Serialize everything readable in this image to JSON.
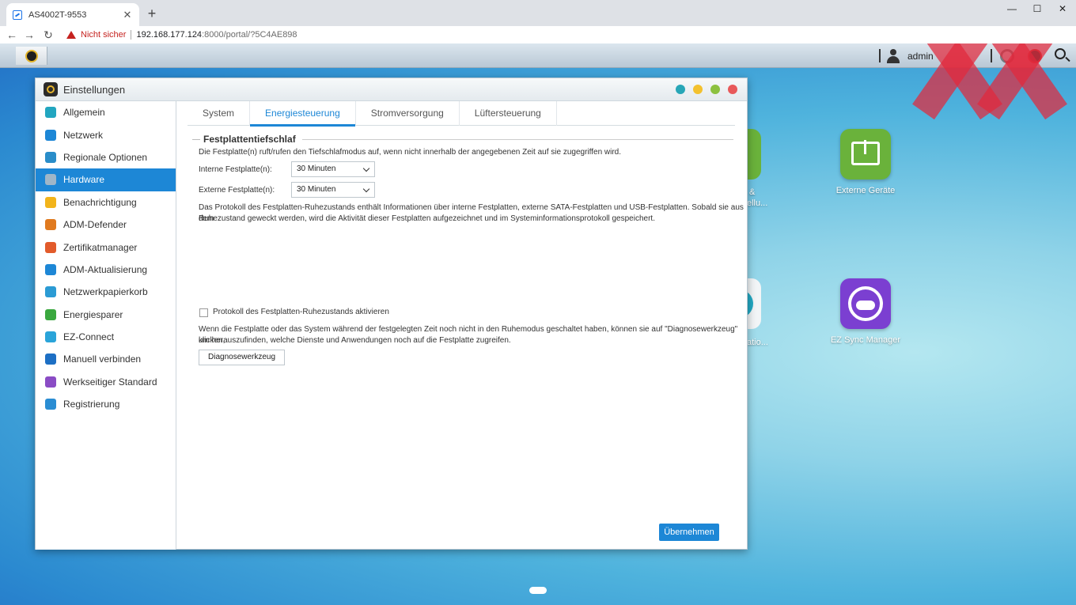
{
  "browser": {
    "tab_title": "AS4002T-9553",
    "insecure_label": "Nicht sicher",
    "url_host": "192.168.177.124",
    "url_path": ":8000/portal/?5C4AE898"
  },
  "taskbar": {
    "username": "admin"
  },
  "desktop": {
    "apps": [
      {
        "label": "Externe Geräte",
        "color": "#6ab23b"
      },
      {
        "label": "EZ Sync Manager",
        "color": "#7b3fd1"
      }
    ],
    "partial_labels": [
      "&",
      "ellu...",
      "atio..."
    ]
  },
  "window": {
    "title": "Einstellungen",
    "dot_colors": [
      "#27a6b7",
      "#f3c12e",
      "#8cc13f",
      "#e8595a"
    ]
  },
  "sidebar": {
    "items": [
      {
        "label": "Allgemein",
        "color": "#22a6c0"
      },
      {
        "label": "Netzwerk",
        "color": "#1d87d6"
      },
      {
        "label": "Regionale Optionen",
        "color": "#2a8dc9"
      },
      {
        "label": "Hardware",
        "color": "#9fb6c8"
      },
      {
        "label": "Benachrichtigung",
        "color": "#f2b41b"
      },
      {
        "label": "ADM-Defender",
        "color": "#e07a1f"
      },
      {
        "label": "Zertifikatmanager",
        "color": "#e25b2b"
      },
      {
        "label": "ADM-Aktualisierung",
        "color": "#1d87d6"
      },
      {
        "label": "Netzwerkpapierkorb",
        "color": "#2b9bd4"
      },
      {
        "label": "Energiesparer",
        "color": "#3aa83f"
      },
      {
        "label": "EZ-Connect",
        "color": "#2aa4d9"
      },
      {
        "label": "Manuell verbinden",
        "color": "#1d6fc4"
      },
      {
        "label": "Werkseitiger Standard",
        "color": "#8a4cc5"
      },
      {
        "label": "Registrierung",
        "color": "#2a8dd3"
      }
    ],
    "active_index": 3
  },
  "tabs": [
    "System",
    "Energiesteuerung",
    "Stromversorgung",
    "Lüftersteuerung"
  ],
  "active_tab": 1,
  "section": {
    "title": "Festplattentiefschlaf",
    "description": "Die Festplatte(n) ruft/rufen den Tiefschlafmodus auf, wenn nicht innerhalb der angegebenen Zeit auf sie zugegriffen wird.",
    "internal_label": "Interne Festplatte(n):",
    "internal_value": "30 Minuten",
    "external_label": "Externe Festplatte(n):",
    "external_value": "30 Minuten",
    "log_info_line1": "Das Protokoll des Festplatten-Ruhezustands enthält Informationen über interne Festplatten, externe SATA-Festplatten und USB-Festplatten. Sobald sie aus dem",
    "log_info_line2": "Ruhezustand geweckt werden, wird die Aktivität dieser Festplatten aufgezeichnet und im Systeminformationsprotokoll gespeichert.",
    "checkbox_label": "Protokoll des Festplatten-Ruhezustands aktivieren",
    "checkbox_checked": false,
    "diag_info_line1": "Wenn die Festplatte oder das System während der festgelegten Zeit noch nicht in den Ruhemodus geschaltet haben, können sie auf \"Diagnosewerkzeug\" klicken,",
    "diag_info_line2": "um herauszufinden, welche Dienste und Anwendungen noch auf die Festplatte zugreifen.",
    "diag_button": "Diagnosewerkzeug",
    "apply_button": "Übernehmen"
  }
}
